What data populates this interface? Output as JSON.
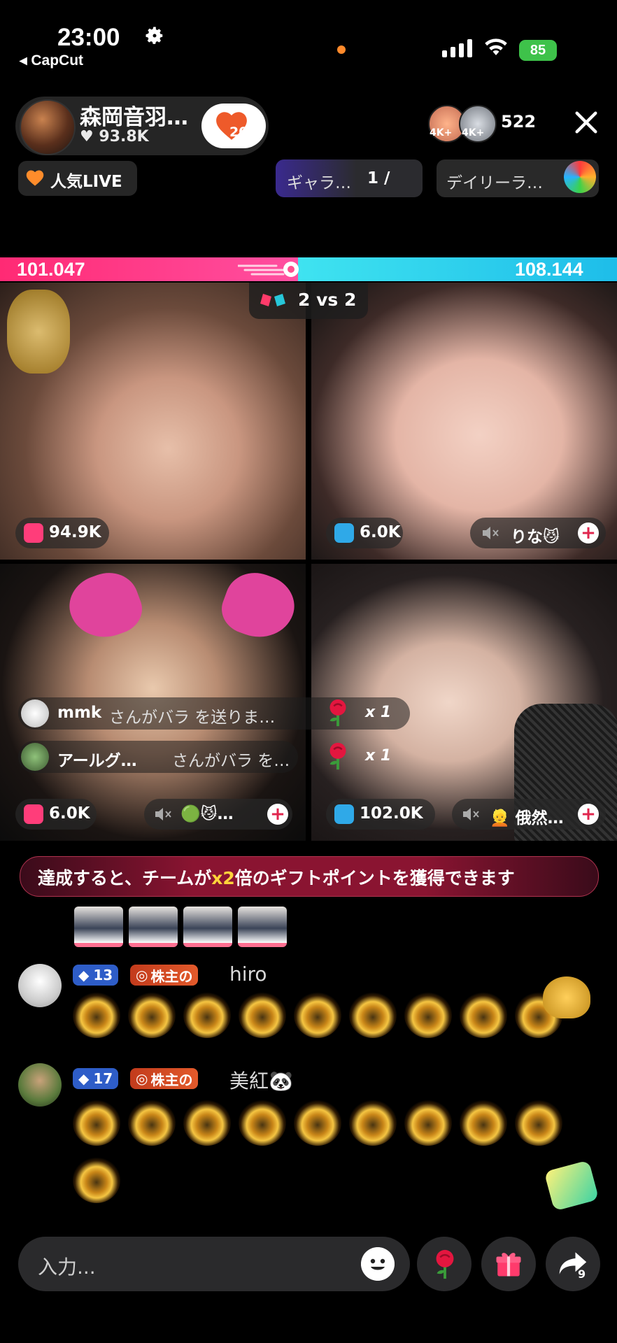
{
  "status_bar": {
    "time": "23:00",
    "back_app": "◂ CapCut",
    "battery": "85"
  },
  "host": {
    "name": "森岡音羽…",
    "likes": "93.8K",
    "follow_count": "20",
    "viewer_count": "522",
    "viewer_badges": [
      "4K+",
      "4K+"
    ]
  },
  "top_pills": {
    "popular": "人気LIVE",
    "gallery": "ギャラ…",
    "gallery_num": "1 /",
    "daily": "デイリーラ…"
  },
  "battle": {
    "left_score": "101.047",
    "right_score": "108.144",
    "left_share": 0.483,
    "mode": "2 vs 2"
  },
  "tiles": [
    {
      "score": "94.9K",
      "team": "pink"
    },
    {
      "score": "6.0K",
      "team": "blue",
      "name": "りな😼"
    },
    {
      "score": "6.0K",
      "team": "pink",
      "name": "🟢😼…"
    },
    {
      "score": "102.0K",
      "team": "blue",
      "name": "👱 俄然…"
    }
  ],
  "gift_feed": [
    {
      "user": "mmk",
      "message": "さんがバラ を送りま…",
      "multiplier": "x 1"
    },
    {
      "user": "アールグ…",
      "message": "さんがバラ を…",
      "multiplier": "x 1"
    }
  ],
  "banner": {
    "before": "達成すると、チームが",
    "highlight": "x2",
    "after": "倍のギフトポイントを獲得できます"
  },
  "chat": [
    {
      "level": "13",
      "badge": "株主の",
      "name": "hiro",
      "gift_count": 9
    },
    {
      "level": "17",
      "badge": "株主の",
      "name": "美紅🐼",
      "gift_count": 10
    }
  ],
  "input": {
    "placeholder": "入力..."
  },
  "share_count": "9",
  "colors": {
    "pink_team": "#ff2a74",
    "blue_team": "#1ebde9",
    "banner_highlight": "#ffd43b"
  }
}
